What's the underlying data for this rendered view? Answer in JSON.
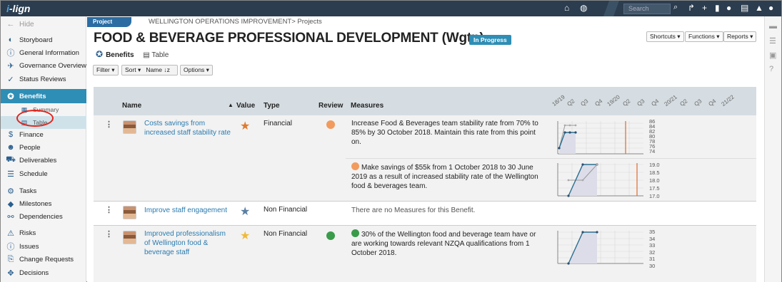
{
  "app": {
    "logo_prefix": "i",
    "logo_suffix": "-lign",
    "search_placeholder": "Search"
  },
  "sidebar": {
    "hide_label": "Hide",
    "items": [
      {
        "label": "Storyboard",
        "icon": "storyboard-icon"
      },
      {
        "label": "General Information",
        "icon": "info-icon"
      },
      {
        "label": "Governance Overview",
        "icon": "governance-icon"
      },
      {
        "label": "Status Reviews",
        "icon": "status-icon"
      },
      {
        "label": "Benefits",
        "icon": "benefits-icon"
      },
      {
        "label": "Summary",
        "icon": "summary-icon"
      },
      {
        "label": "Table",
        "icon": "table-icon"
      },
      {
        "label": "Finance",
        "icon": "dollar-icon"
      },
      {
        "label": "People",
        "icon": "people-icon"
      },
      {
        "label": "Deliverables",
        "icon": "deliverables-icon"
      },
      {
        "label": "Schedule",
        "icon": "schedule-icon"
      },
      {
        "label": "Tasks",
        "icon": "tasks-icon"
      },
      {
        "label": "Milestones",
        "icon": "milestones-icon"
      },
      {
        "label": "Dependencies",
        "icon": "dependencies-icon"
      },
      {
        "label": "Risks",
        "icon": "risks-icon"
      },
      {
        "label": "Issues",
        "icon": "issues-icon"
      },
      {
        "label": "Change Requests",
        "icon": "change-icon"
      },
      {
        "label": "Decisions",
        "icon": "decisions-icon"
      }
    ]
  },
  "header": {
    "project_tab": "Project",
    "breadcrumb": "WELLINGTON OPERATIONS IMPROVEMENT> Projects",
    "title": "FOOD & BEVERAGE PROFESSIONAL DEVELOPMENT (Wgtn)",
    "status": "In Progress",
    "shortcuts": "Shortcuts",
    "functions": "Functions",
    "reports": "Reports",
    "section": "Benefits",
    "view": "Table"
  },
  "toolbar": {
    "filter": "Filter",
    "sort": "Sort",
    "sort_field": "Name",
    "options": "Options"
  },
  "columns": {
    "name": "Name",
    "value": "Value",
    "type": "Type",
    "review": "Review",
    "measures": "Measures"
  },
  "quarters": [
    "18/19",
    "Q2",
    "Q3",
    "Q4",
    "19/20",
    "Q2",
    "Q3",
    "Q4",
    "20/21",
    "Q2",
    "Q3",
    "Q4",
    "21/22"
  ],
  "benefits": [
    {
      "name": "Costs savings from increased staff stability rate",
      "type": "Financial",
      "star_color": "#e07a2e",
      "review_color": "#f29b5c",
      "measures": [
        {
          "text": "Increase Food & Beverages team stability rate from 70% to 85% by 30 October 2018. Maintain this rate from this point on.",
          "dot": "",
          "ylabels": [
            "86",
            "84",
            "82",
            "80",
            "78",
            "76",
            "74"
          ]
        },
        {
          "text": "Make savings of $55k from 1 October 2018 to 30 June 2019 as a result of increased stability rate of the Wellington food & beverages team.",
          "dot": "#f29b5c",
          "ylabels": [
            "19.0",
            "18.5",
            "18.0",
            "17.5",
            "17.0"
          ]
        }
      ]
    },
    {
      "name": "Improve staff engagement",
      "type": "Non Financial",
      "star_color": "#5b7fa3",
      "review_color": "",
      "no_measures": "There are no Measures for this Benefit."
    },
    {
      "name": "Improved professionalism of Wellington food & beverage staff",
      "type": "Non Financial",
      "star_color": "#f0b93a",
      "review_color": "#3a9b4a",
      "measures": [
        {
          "text": "30% of the Wellington food and beverage team have or are working towards relevant NZQA qualifications from 1 October 2018.",
          "dot": "#3a9b4a",
          "ylabels": [
            "35",
            "34",
            "33",
            "32",
            "31",
            "30"
          ]
        }
      ]
    }
  ]
}
